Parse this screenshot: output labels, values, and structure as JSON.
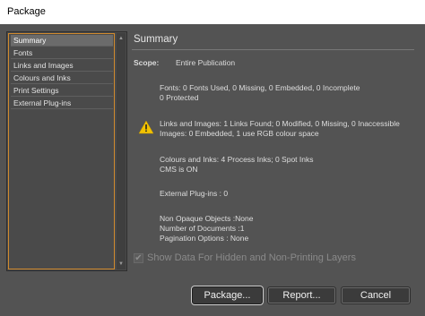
{
  "window": {
    "title": "Package"
  },
  "sidebar": {
    "items": [
      {
        "label": "Summary"
      },
      {
        "label": "Fonts"
      },
      {
        "label": "Links and Images"
      },
      {
        "label": "Colours and Inks"
      },
      {
        "label": "Print Settings"
      },
      {
        "label": "External Plug-ins"
      }
    ],
    "selected": "Summary"
  },
  "main": {
    "heading": "Summary",
    "scope_label": "Scope:",
    "scope_value": "Entire Publication",
    "fonts_line1": "Fonts: 0 Fonts Used, 0 Missing, 0 Embedded, 0 Incomplete",
    "fonts_line2": "0 Protected",
    "links_line1": "Links and Images: 1 Links Found; 0 Modified, 0 Missing, 0 Inaccessible",
    "links_line2": "Images: 0 Embedded, 1 use RGB colour space",
    "colours_line1": "Colours and Inks: 4 Process Inks; 0 Spot Inks",
    "colours_line2": "CMS is ON",
    "plugins_line": "External Plug-ins : 0",
    "misc_line1": "Non Opaque Objects :None",
    "misc_line2": "Number of Documents :1",
    "misc_line3": "Pagination Options : None",
    "show_hidden_label": "Show Data For Hidden and Non-Printing Layers",
    "show_hidden_checked": true,
    "warning_icon": "warning-triangle-icon"
  },
  "buttons": {
    "package": "Package...",
    "report": "Report...",
    "cancel": "Cancel"
  },
  "colors": {
    "background": "#535353",
    "accent_focus": "#d08a2d",
    "warning": "#f2c200"
  }
}
